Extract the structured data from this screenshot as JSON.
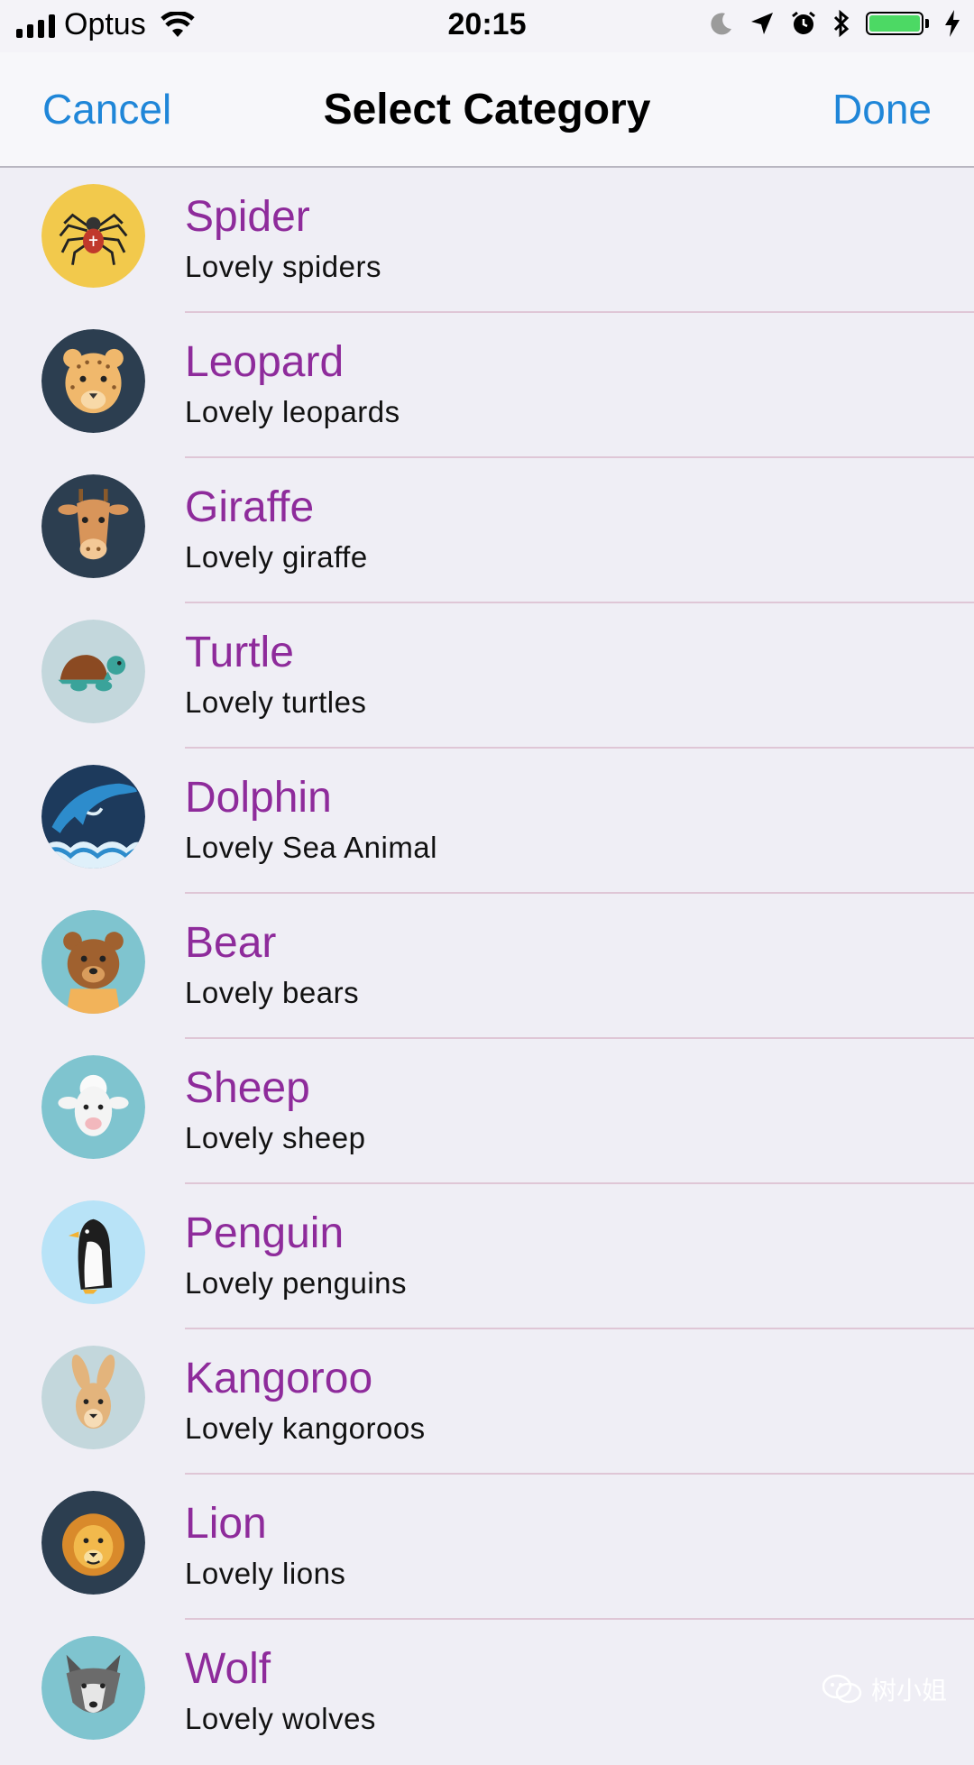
{
  "status_bar": {
    "carrier": "Optus",
    "time": "20:15",
    "battery_color": "#4cd964"
  },
  "navbar": {
    "cancel_label": "Cancel",
    "title": "Select Category",
    "done_label": "Done",
    "accent_color": "#1f86d8"
  },
  "categories": [
    {
      "title": "Spider",
      "subtitle": "Lovely spiders",
      "icon": "spider-icon"
    },
    {
      "title": "Leopard",
      "subtitle": "Lovely leopards",
      "icon": "leopard-icon"
    },
    {
      "title": "Giraffe",
      "subtitle": "Lovely giraffe",
      "icon": "giraffe-icon"
    },
    {
      "title": "Turtle",
      "subtitle": "Lovely turtles",
      "icon": "turtle-icon"
    },
    {
      "title": "Dolphin",
      "subtitle": "Lovely Sea Animal",
      "icon": "dolphin-icon"
    },
    {
      "title": "Bear",
      "subtitle": "Lovely bears",
      "icon": "bear-icon"
    },
    {
      "title": "Sheep",
      "subtitle": "Lovely sheep",
      "icon": "sheep-icon"
    },
    {
      "title": "Penguin",
      "subtitle": "Lovely penguins",
      "icon": "penguin-icon"
    },
    {
      "title": "Kangoroo",
      "subtitle": "Lovely kangoroos",
      "icon": "kangaroo-icon"
    },
    {
      "title": "Lion",
      "subtitle": "Lovely lions",
      "icon": "lion-icon"
    },
    {
      "title": "Wolf",
      "subtitle": "Lovely wolves",
      "icon": "wolf-icon"
    }
  ],
  "title_color": "#8e2b9b",
  "watermark": "树小姐"
}
